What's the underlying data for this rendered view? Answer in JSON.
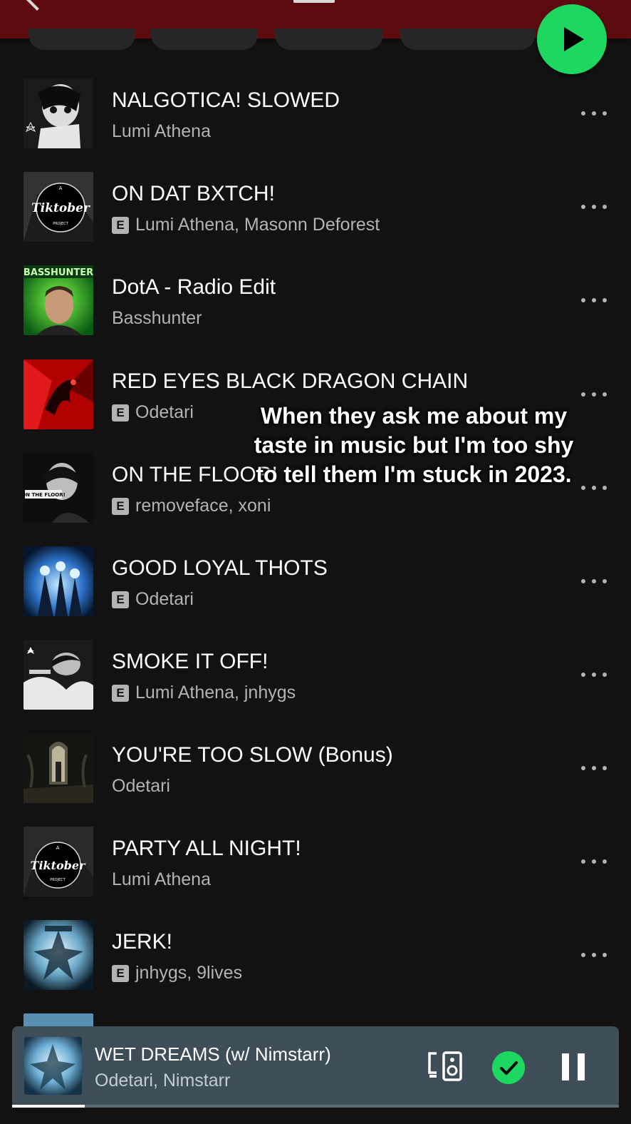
{
  "header": {
    "play_button_color": "#1ed760",
    "background_color": "#5e0b10"
  },
  "tracks": [
    {
      "title": "NALGOTICA! SLOWED",
      "artist": "Lumi Athena",
      "explicit": false
    },
    {
      "title": "ON DAT BXTCH!",
      "artist": "Lumi Athena, Masonn Deforest",
      "explicit": true
    },
    {
      "title": "DotA - Radio Edit",
      "artist": "Basshunter",
      "explicit": false
    },
    {
      "title": "RED EYES BLACK DRAGON CHAIN",
      "artist": "Odetari",
      "explicit": true
    },
    {
      "title": "ON THE FLOOR!",
      "artist": "removeface, xoni",
      "explicit": true
    },
    {
      "title": "GOOD LOYAL THOTS",
      "artist": "Odetari",
      "explicit": true
    },
    {
      "title": "SMOKE IT OFF!",
      "artist": "Lumi Athena, jnhygs",
      "explicit": true
    },
    {
      "title": "YOU'RE TOO SLOW (Bonus)",
      "artist": "Odetari",
      "explicit": false
    },
    {
      "title": "PARTY ALL NIGHT!",
      "artist": "Lumi Athena",
      "explicit": false
    },
    {
      "title": "JERK!",
      "artist": "jnhygs, 9lives",
      "explicit": true
    }
  ],
  "explicit_label": "E",
  "covers": {
    "tiktober_logo_text": "Tiktober",
    "tiktober_top": "A",
    "tiktober_bottom": "PROJECT",
    "basshunter_logo": "BASSHUNTER",
    "on_the_floor_text": "ON THE FLOOR!"
  },
  "caption": {
    "text": "When they ask me about my taste in music but I'm too shy to tell them I'm stuck in 2023."
  },
  "now_playing": {
    "title": "WET DREAMS (w/ Nimstarr)",
    "artist": "Odetari, Nimstarr",
    "saved": true,
    "progress": 0.12,
    "bar_color": "#3d4e59"
  }
}
